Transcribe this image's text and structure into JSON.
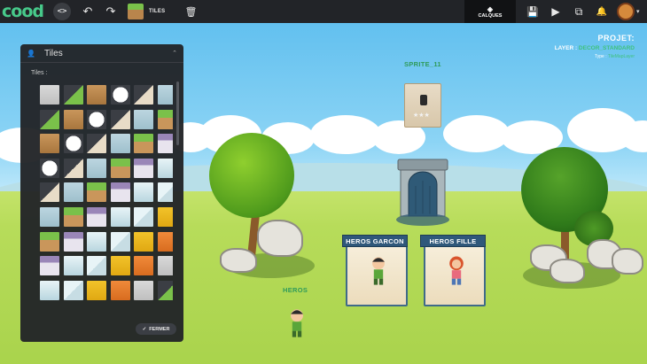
{
  "topbar": {
    "logo": "cood",
    "code_glyph": "<>",
    "undo_glyph": "↶",
    "redo_glyph": "↷",
    "tiles_label": "TILES",
    "delete_glyph": "🗑",
    "layers_icon": "layers-icon",
    "layers_label": "CALQUES",
    "save_glyph": "💾",
    "play_glyph": "▶",
    "export_glyph": "⧉",
    "bell_glyph": "🔔",
    "caret": "▾"
  },
  "project": {
    "title": "PROJET:",
    "layer_label": "LAYER : ",
    "layer_value": "DECOR_STANDARD",
    "type_label": "Type : ",
    "type_value": "TileMapLayer"
  },
  "tiles_panel": {
    "user_icon": "👤",
    "title": "Tiles",
    "collapse_glyph": "⌃",
    "subtitle": "Tiles :",
    "close_label": "FERMER",
    "close_icon": "✓"
  },
  "scene": {
    "sprite_label": "SPRITE_11",
    "heros_label": "HEROS",
    "card_boy": "HEROS GARCON",
    "card_girl": "HEROS FILLE"
  },
  "colors": {
    "accent_green": "#3fc27e",
    "topbar_bg": "#222428",
    "banner_blue": "#2f587a"
  }
}
